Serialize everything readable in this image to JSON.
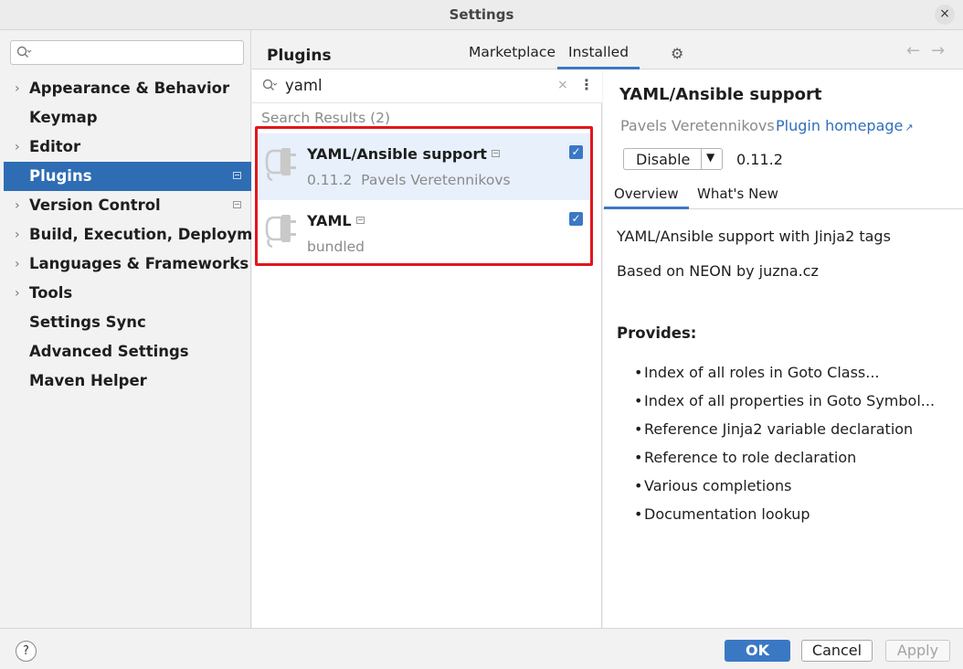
{
  "window": {
    "title": "Settings",
    "close_glyph": "×"
  },
  "sidebar": {
    "search_placeholder": "",
    "items": [
      {
        "label": "Appearance & Behavior",
        "expandable": true,
        "badge": false
      },
      {
        "label": "Keymap",
        "expandable": false,
        "badge": false
      },
      {
        "label": "Editor",
        "expandable": true,
        "badge": false
      },
      {
        "label": "Plugins",
        "expandable": false,
        "badge": true,
        "selected": true
      },
      {
        "label": "Version Control",
        "expandable": true,
        "badge": true
      },
      {
        "label": "Build, Execution, Deployment",
        "expandable": true,
        "badge": false
      },
      {
        "label": "Languages & Frameworks",
        "expandable": true,
        "badge": false
      },
      {
        "label": "Tools",
        "expandable": true,
        "badge": false
      },
      {
        "label": "Settings Sync",
        "expandable": false,
        "badge": false
      },
      {
        "label": "Advanced Settings",
        "expandable": false,
        "badge": false
      },
      {
        "label": "Maven Helper",
        "expandable": false,
        "badge": false
      }
    ]
  },
  "header": {
    "heading": "Plugins",
    "tabs": [
      {
        "label": "Marketplace"
      },
      {
        "label": "Installed",
        "active": true
      }
    ],
    "settings_icon": "gear-icon",
    "back_glyph": "←",
    "forward_glyph": "→"
  },
  "plugin_search": {
    "query": "yaml",
    "clear_glyph": "×",
    "more_glyph": "⋮"
  },
  "results": {
    "label": "Search Results (2)",
    "plugins": [
      {
        "name": "YAML/Ansible support",
        "version": "0.11.2",
        "vendor": "Pavels Veretennikovs",
        "enabled": true,
        "selected": true
      },
      {
        "name": "YAML",
        "subtitle": "bundled",
        "enabled": true
      }
    ]
  },
  "details": {
    "title": "YAML/Ansible support",
    "vendor": "Pavels Veretennikovs",
    "homepage_label": "Plugin homepage",
    "homepage_glyph": "↗",
    "action_label": "Disable",
    "version": "0.11.2",
    "tabs": [
      {
        "label": "Overview",
        "active": true
      },
      {
        "label": "What's New"
      }
    ],
    "description_1": "YAML/Ansible support with Jinja2 tags",
    "description_2": "Based on NEON by juzna.cz",
    "provides_heading": "Provides:",
    "provides": [
      "Index of all roles in Goto Class...",
      "Index of all properties in Goto Symbol...",
      "Reference Jinja2 variable declaration",
      "Reference to role declaration",
      "Various completions",
      "Documentation lookup"
    ]
  },
  "footer": {
    "help_glyph": "?",
    "ok_label": "OK",
    "cancel_label": "Cancel",
    "apply_label": "Apply"
  },
  "colors": {
    "accent": "#3b78c4",
    "selection": "#2e6db4",
    "highlight_border": "#e0161e",
    "link": "#2f6fba"
  }
}
